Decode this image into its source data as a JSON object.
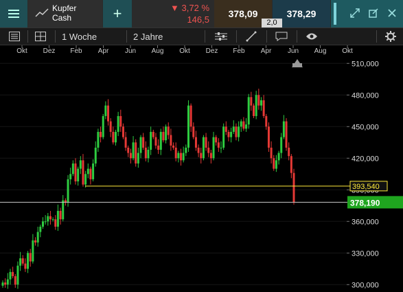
{
  "instrument": {
    "name_line1": "Kupfer",
    "name_line2": "Cash"
  },
  "quote": {
    "change_pct": "▼ 3,72 %",
    "change_abs": "146,5",
    "bid": "378,09",
    "ask": "378,29",
    "spread": "2,0"
  },
  "toolbar": {
    "period": "1 Woche",
    "range": "2 Jahre"
  },
  "colors": {
    "up": "#2ecc40",
    "down": "#e53935",
    "accent": "#1f4f55",
    "marker_yellow": "#ffeb3b"
  },
  "icons": [
    "menu-icon",
    "trend-icon",
    "plus-icon",
    "expand-icon",
    "popout-icon",
    "close-icon",
    "list-icon",
    "grid-icon",
    "indicators-icon",
    "comment-icon",
    "eye-icon",
    "gear-icon"
  ],
  "chart_data": {
    "type": "candlestick",
    "x_ticks": [
      "Okt",
      "Dez",
      "Feb",
      "Apr",
      "Jun",
      "Aug",
      "Okt",
      "Dez",
      "Feb",
      "Apr",
      "Jun",
      "Aug",
      "Okt"
    ],
    "y_ticks": [
      "300,000",
      "330,000",
      "360,000",
      "390,000",
      "420,000",
      "450,000",
      "480,000",
      "510,000"
    ],
    "ylim": [
      293,
      518
    ],
    "price_lines": [
      {
        "value": 393.54,
        "label": "393,540",
        "color": "#ffeb3b"
      },
      {
        "value": 378.19,
        "label": "378,190",
        "color": "#cccccc"
      }
    ],
    "last_price_tag": "378,190",
    "closes": [
      302,
      300,
      305,
      312,
      308,
      300,
      318,
      325,
      320,
      315,
      330,
      322,
      342,
      340,
      350,
      355,
      360,
      360,
      365,
      362,
      362,
      355,
      370,
      362,
      380,
      378,
      400,
      405,
      415,
      398,
      410,
      418,
      395,
      405,
      410,
      400,
      415,
      430,
      445,
      440,
      460,
      470,
      455,
      445,
      435,
      445,
      460,
      450,
      440,
      430,
      425,
      420,
      435,
      415,
      425,
      440,
      430,
      420,
      428,
      445,
      440,
      432,
      428,
      445,
      437,
      450,
      442,
      432,
      430,
      420,
      425,
      418,
      425,
      430,
      470,
      450,
      440,
      430,
      425,
      420,
      440,
      430,
      425,
      420,
      440,
      435,
      430,
      430,
      450,
      445,
      440,
      445,
      450,
      440,
      450,
      455,
      448,
      452,
      478,
      470,
      460,
      480,
      470,
      475,
      460,
      450,
      430,
      420,
      410,
      418,
      425,
      440,
      455,
      430,
      422,
      406,
      378
    ]
  }
}
